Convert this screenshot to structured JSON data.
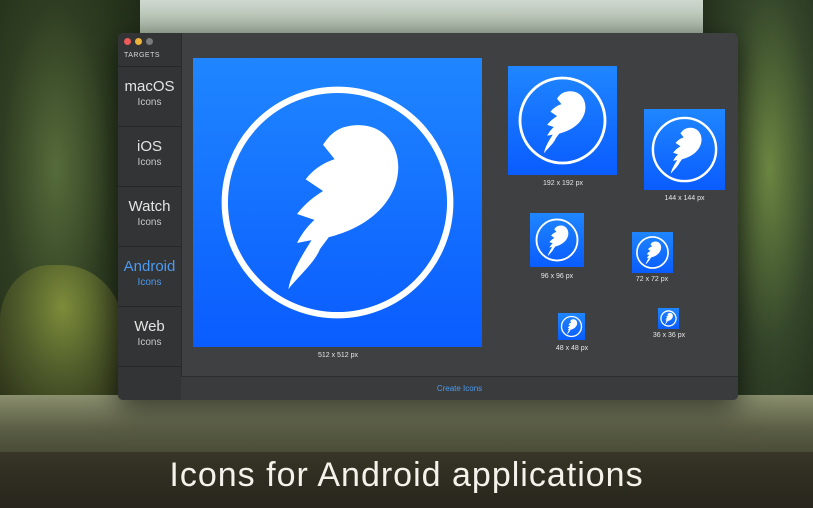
{
  "sidebar": {
    "title": "TARGETS",
    "items": [
      {
        "name": "macOS",
        "sub": "Icons"
      },
      {
        "name": "iOS",
        "sub": "Icons"
      },
      {
        "name": "Watch",
        "sub": "Icons"
      },
      {
        "name": "Android",
        "sub": "Icons"
      },
      {
        "name": "Web",
        "sub": "Icons"
      }
    ],
    "selected": "Android"
  },
  "icons": [
    {
      "label": "512 x 512 px"
    },
    {
      "label": "192 x 192 px"
    },
    {
      "label": "144 x 144 px"
    },
    {
      "label": "96 x 96 px"
    },
    {
      "label": "72 x 72 px"
    },
    {
      "label": "48 x 48 px"
    },
    {
      "label": "36 x 36 px"
    }
  ],
  "footer": {
    "create_label": "Create Icons"
  },
  "caption": "Icons for Android applications",
  "colors": {
    "accent": "#4b9bf2",
    "icon_blue": "#1a78ff"
  }
}
